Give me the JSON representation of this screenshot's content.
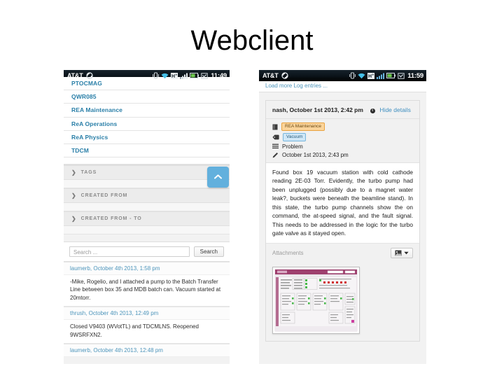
{
  "slide": {
    "title": "Webclient"
  },
  "phone_left": {
    "statusbar": {
      "carrier": "AT&T",
      "clock": "11:49",
      "icons": [
        "sync-icon",
        "vibrate-icon",
        "wifi-icon",
        "hspa-plus-icon",
        "signal-bars-icon",
        "battery-icon",
        "alarm-icon"
      ]
    },
    "filter_list": {
      "items": [
        {
          "label": "PTOCMAG",
          "clipped": true
        },
        {
          "label": "QWR085",
          "clipped": false
        },
        {
          "label": "REA Maintenance",
          "clipped": false
        },
        {
          "label": "ReA Operations",
          "clipped": false
        },
        {
          "label": "ReA Physics",
          "clipped": false
        },
        {
          "label": "TDCM",
          "clipped": false
        }
      ]
    },
    "accordions": [
      {
        "label": "TAGS"
      },
      {
        "label": "CREATED FROM"
      },
      {
        "label": "CREATED FROM - TO"
      }
    ],
    "scroll_top_button": {
      "icon": "chevron-up-icon"
    },
    "search": {
      "placeholder": "Search ...",
      "value": "",
      "button_label": "Search"
    },
    "log_entries": [
      {
        "header": "laumerb, October 4th 2013, 1:58 pm",
        "body": "-Mike, Rogelio, and I attached a pump to the Batch Transfer Line between box 35 and MDB batch can. Vacuum started at 20mtorr."
      },
      {
        "header": "thrush, October 4th 2013, 12:49 pm",
        "body": "Closed V9403 (WVotTL) and TDCMLNS. Reopened 9WSRFXN2."
      },
      {
        "header": "laumerb, October 4th 2013, 12:48 pm",
        "body": ""
      }
    ]
  },
  "phone_right": {
    "statusbar": {
      "carrier": "AT&T",
      "clock": "11:59",
      "icons": [
        "sync-icon",
        "vibrate-icon",
        "wifi-icon",
        "hspa-plus-icon",
        "signal-bars-icon",
        "battery-icon",
        "alarm-icon"
      ]
    },
    "load_more_label": "Load more Log entries ...",
    "entry": {
      "author_and_date": "nash, October 1st 2013, 2:42 pm",
      "hide_details_label": "Hide details",
      "info_icon": "info-icon",
      "logbook": {
        "icon": "logbook-icon",
        "label": "REA Maintenance"
      },
      "tag": {
        "icon": "tag-icon",
        "label": "Vacuum"
      },
      "category": {
        "icon": "list-icon",
        "label": "Problem"
      },
      "edited": {
        "icon": "pencil-icon",
        "label": "October 1st 2013, 2:43 pm"
      },
      "body": "Found box 19 vacuum station with cold cathode reading 2E-03 Torr. Evidently, the turbo pump had been unplugged (possibly due to a magnet water leak?, buckets were beneath the beamline stand). In this state, the turbo pump channels show the on command, the at-speed signal, and the fault signal. This needs to be addressed in the logic for the turbo gate valve as it stayed open."
    },
    "attachments": {
      "label": "Attachments",
      "menu_icon": "image-icon",
      "caret_icon": "caret-down-icon",
      "thumbnail_name": "control-system-screenshot-thumbnail"
    }
  },
  "colors": {
    "link": "#2a7fa8",
    "accent_blue": "#62b0dd",
    "logbook_badge": "#fbd49a",
    "tag_badge": "#cfe7f7",
    "statusbar": "#0c1a24"
  }
}
